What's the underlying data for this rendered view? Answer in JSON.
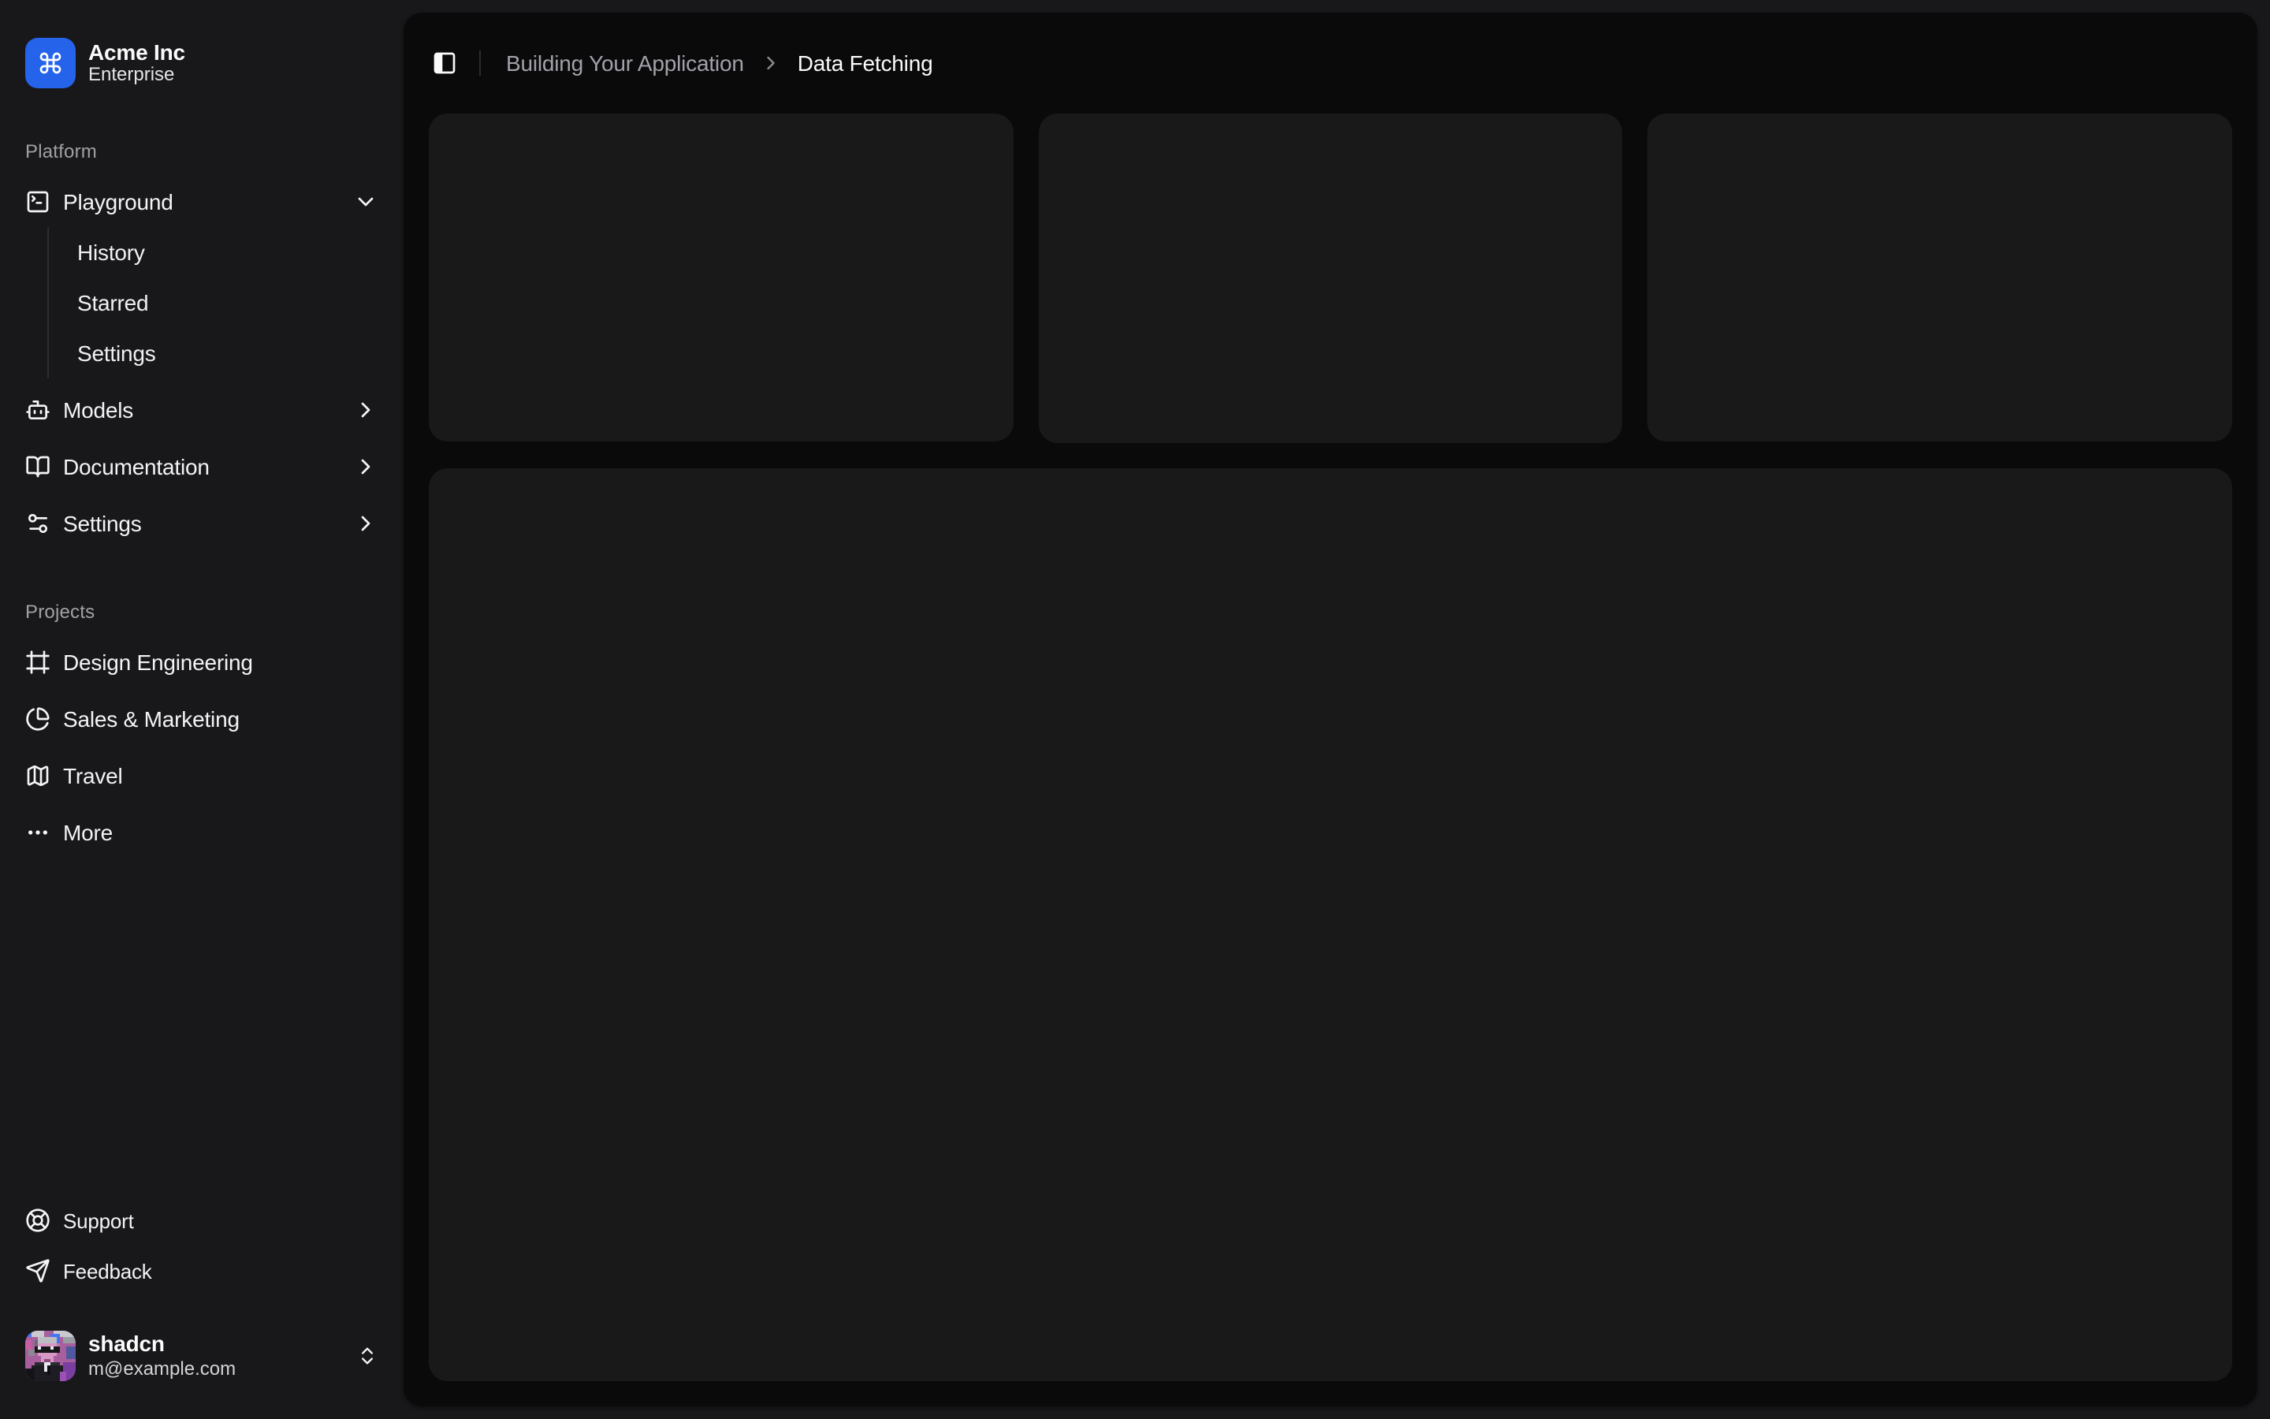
{
  "sidebar": {
    "header": {
      "name": "Acme Inc",
      "plan": "Enterprise",
      "logo_icon": "command-icon",
      "logo_color": "#2563eb"
    },
    "groups": [
      {
        "label": "Platform",
        "items": [
          {
            "label": "Playground",
            "icon": "square-terminal-icon",
            "state": "expanded",
            "children": [
              {
                "label": "History"
              },
              {
                "label": "Starred"
              },
              {
                "label": "Settings"
              }
            ]
          },
          {
            "label": "Models",
            "icon": "bot-icon",
            "state": "collapsed"
          },
          {
            "label": "Documentation",
            "icon": "book-open-icon",
            "state": "collapsed"
          },
          {
            "label": "Settings",
            "icon": "settings-icon",
            "state": "collapsed"
          }
        ]
      },
      {
        "label": "Projects",
        "items": [
          {
            "label": "Design Engineering",
            "icon": "frame-icon"
          },
          {
            "label": "Sales & Marketing",
            "icon": "chart-pie-icon"
          },
          {
            "label": "Travel",
            "icon": "map-icon"
          },
          {
            "label": "More",
            "icon": "ellipsis-icon"
          }
        ]
      }
    ],
    "secondary_items": [
      {
        "label": "Support",
        "icon": "life-buoy-icon"
      },
      {
        "label": "Feedback",
        "icon": "send-icon"
      }
    ],
    "user": {
      "name": "shadcn",
      "email": "m@example.com",
      "menu_icon": "chevrons-up-down-icon"
    }
  },
  "header": {
    "trigger_icon": "panel-left-icon",
    "breadcrumb": {
      "parent": "Building Your Application",
      "current": "Data Fetching"
    }
  },
  "main": {
    "placeholder_card_count": 3,
    "placeholder_panel_count": 1
  },
  "colors": {
    "page_background": "#18181b",
    "inset_background": "#0a0a0b",
    "card_background": "rgba(39,39,42,0.5)",
    "brand_blue": "#2563eb",
    "text_primary": "#fafafa",
    "text_muted": "#a1a1aa"
  }
}
